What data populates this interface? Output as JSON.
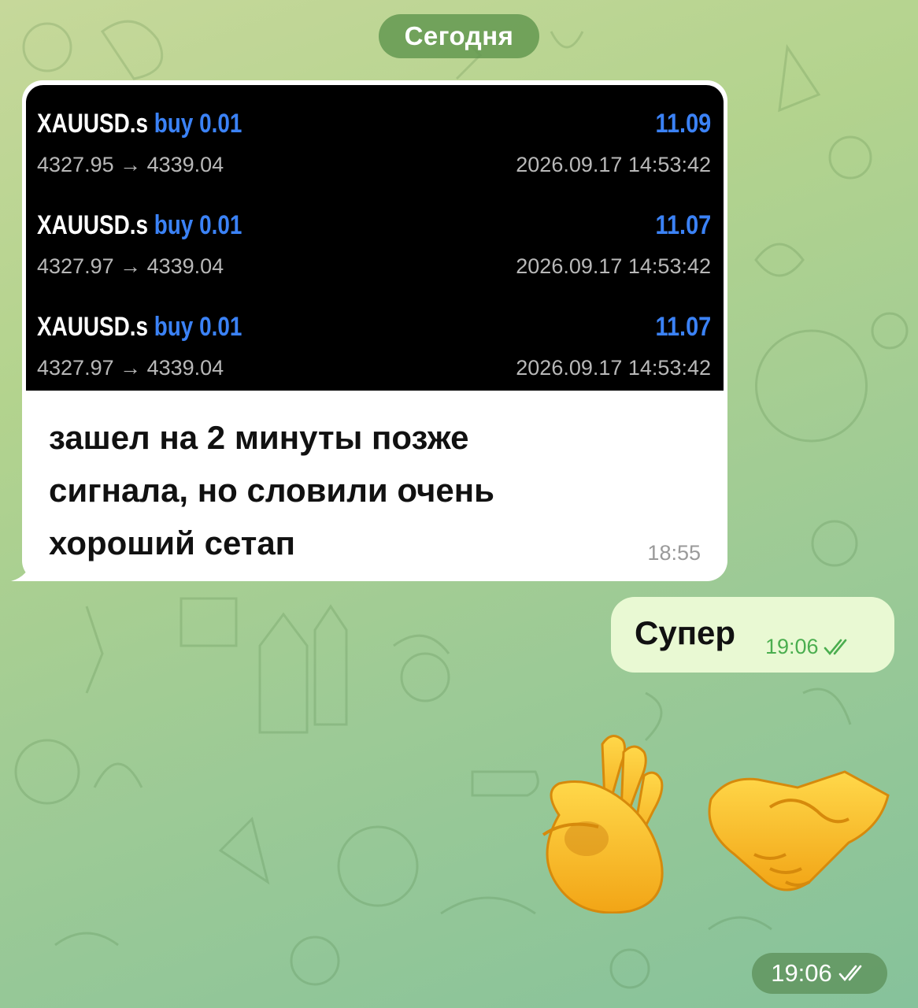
{
  "date_divider": "Сегодня",
  "incoming_message": {
    "trades": [
      {
        "symbol": "XAUUSD.s",
        "side": "buy",
        "lot": "0.01",
        "prices": "4327.95 → 4339.04",
        "profit": "11.09",
        "datetime": "2026.09.17 14:53:42"
      },
      {
        "symbol": "XAUUSD.s",
        "side": "buy",
        "lot": "0.01",
        "prices": "4327.97 → 4339.04",
        "profit": "11.07",
        "datetime": "2026.09.17 14:53:42"
      },
      {
        "symbol": "XAUUSD.s",
        "side": "buy",
        "lot": "0.01",
        "prices": "4327.97 → 4339.04",
        "profit": "11.07",
        "datetime": "2026.09.17 14:53:42"
      }
    ],
    "text_lines": [
      "зашел на 2 минуты позже",
      "сигнала, но словили очень",
      "хороший сетап"
    ],
    "time": "18:55"
  },
  "outgoing_message": {
    "text": "Супер",
    "time": "19:06",
    "status_icon": "double-check-icon"
  },
  "emoji_message": {
    "emojis": [
      "ok-hand-emoji",
      "handshake-emoji"
    ],
    "time": "19:06",
    "status_icon": "double-check-icon"
  },
  "colors": {
    "accent_blue": "#3b82f6",
    "outgoing_bubble": "#e9f9d3",
    "read_check_green": "#4bae4f"
  }
}
